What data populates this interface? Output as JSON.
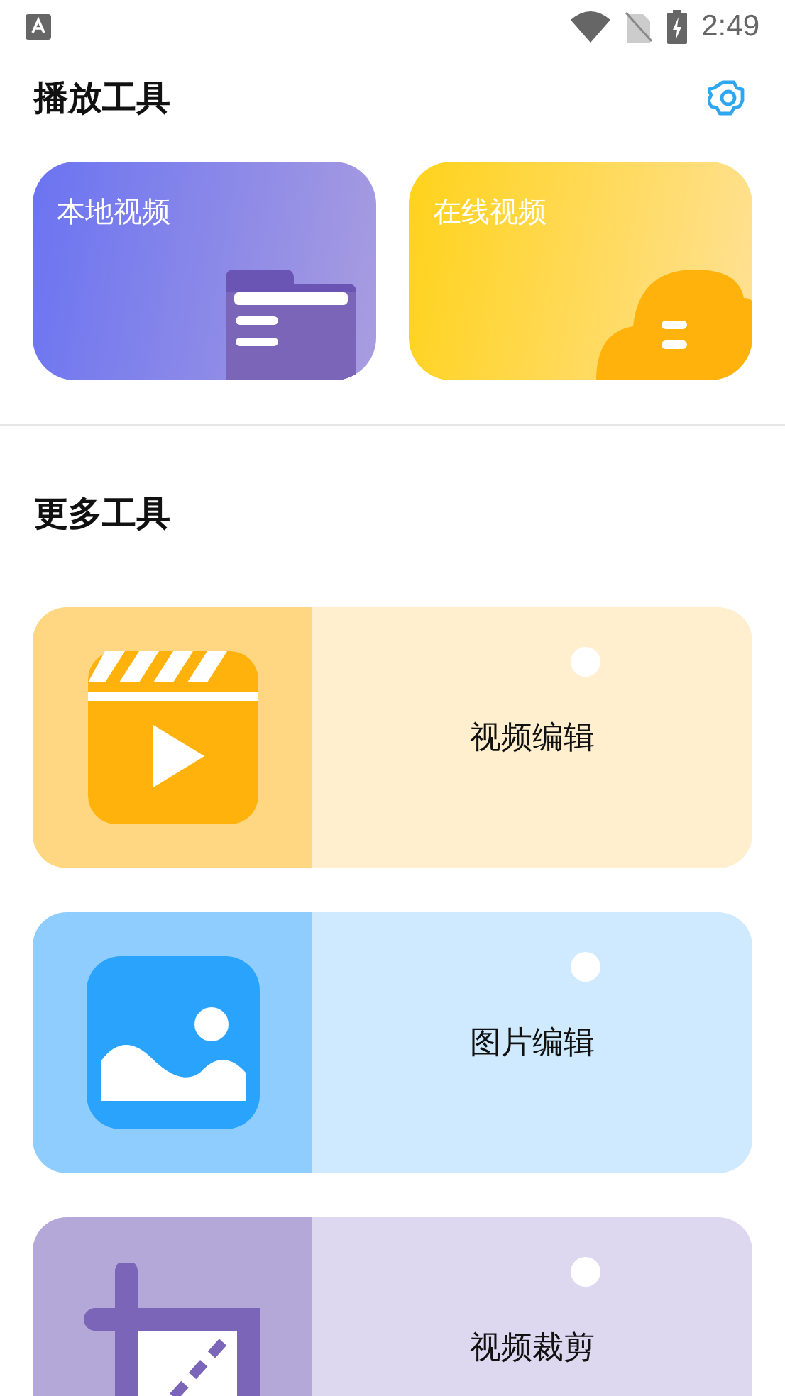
{
  "status_bar": {
    "time": "2:49"
  },
  "play_section": {
    "title": "播放工具",
    "cards": [
      {
        "kind": "local",
        "label": "本地视频"
      },
      {
        "kind": "online",
        "label": "在线视频"
      }
    ]
  },
  "more_section": {
    "title": "更多工具",
    "tools": [
      {
        "kind": "video",
        "label": "视频编辑"
      },
      {
        "kind": "image",
        "label": "图片编辑"
      },
      {
        "kind": "crop",
        "label": "视频裁剪"
      }
    ]
  }
}
